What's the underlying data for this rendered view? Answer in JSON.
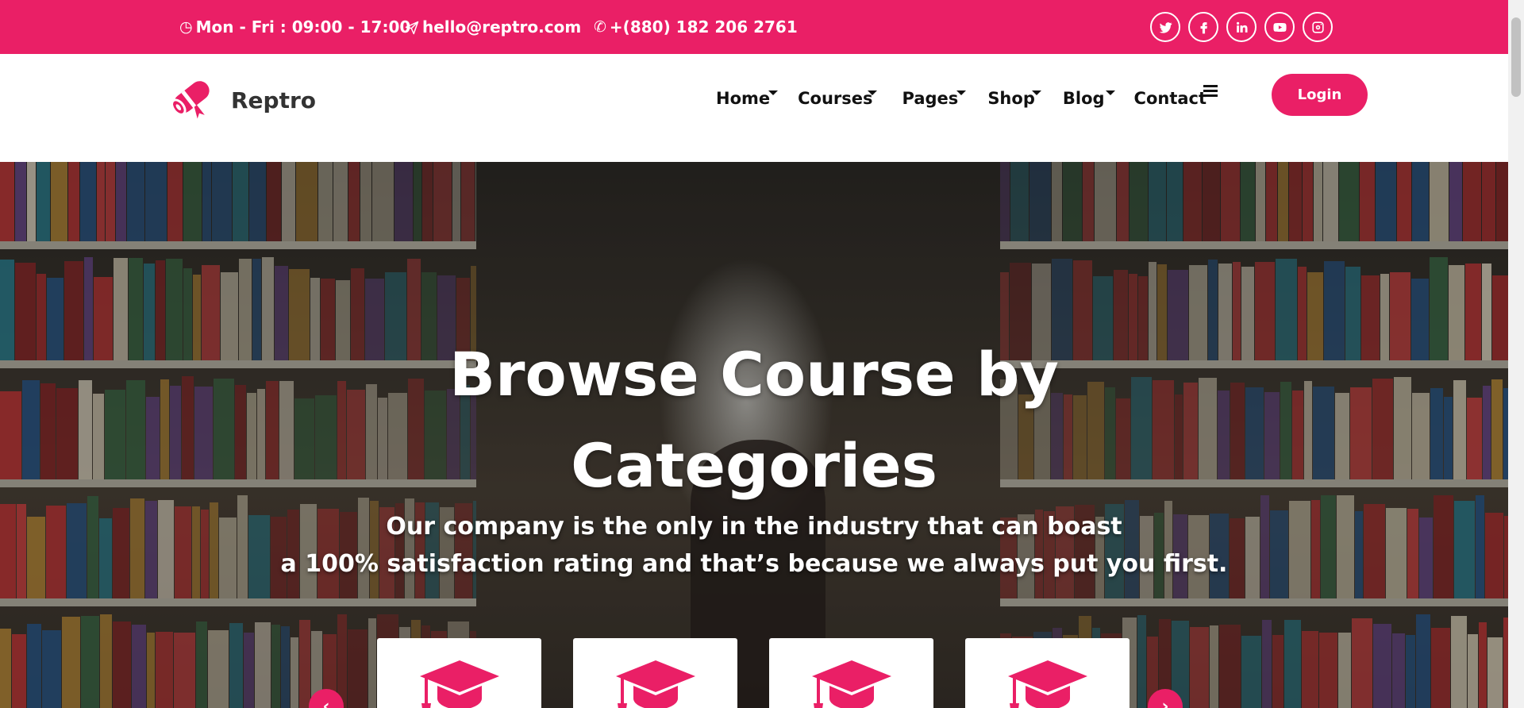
{
  "topbar": {
    "hours": "Mon - Fri : 09:00 - 17:00",
    "email": "hello@reptro.com",
    "phone": "+(880) 182 206 2761",
    "socials": [
      "twitter-icon",
      "facebook-icon",
      "linkedin-icon",
      "youtube-icon",
      "instagram-icon"
    ]
  },
  "header": {
    "brand": "Reptro",
    "nav": [
      {
        "label": "Home",
        "has_dropdown": true
      },
      {
        "label": "Courses",
        "has_dropdown": true
      },
      {
        "label": "Pages",
        "has_dropdown": true
      },
      {
        "label": "Shop",
        "has_dropdown": true
      },
      {
        "label": "Blog",
        "has_dropdown": true
      },
      {
        "label": "Contact",
        "has_dropdown": false
      }
    ],
    "login_label": "Login"
  },
  "hero": {
    "title_line1": "Browse Course by",
    "title_line2": "Categories",
    "subtitle_line1": "Our company is the only in the industry that can boast",
    "subtitle_line2": "a 100% satisfaction rating and that’s because we always put you first.",
    "cards": [
      {
        "icon": "graduation-cap-icon"
      },
      {
        "icon": "graduation-cap-icon"
      },
      {
        "icon": "graduation-cap-icon"
      },
      {
        "icon": "graduation-cap-icon"
      }
    ]
  },
  "colors": {
    "accent": "#ea1f66",
    "white": "#ffffff",
    "text_dark": "#111111"
  }
}
